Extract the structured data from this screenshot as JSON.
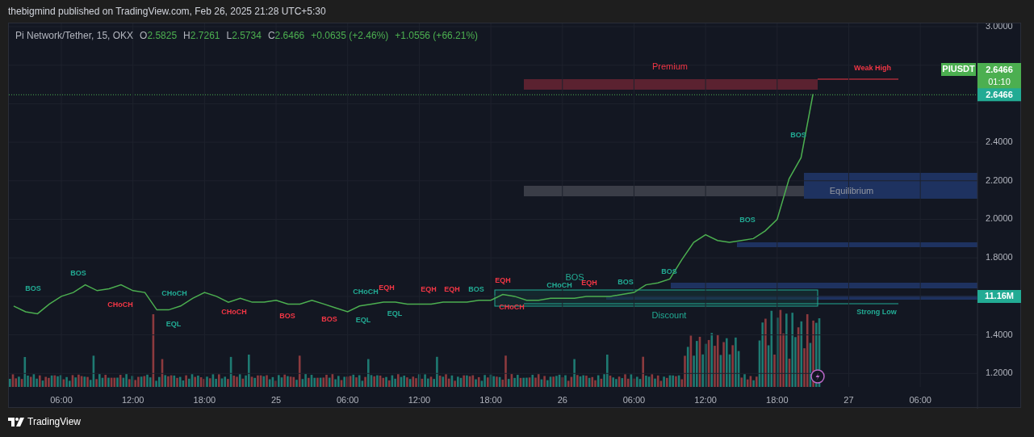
{
  "header": {
    "text": "thebigmind published on TradingView.com, Feb 26, 2025 21:28 UTC+5:30"
  },
  "legend": {
    "symbol": "Pi Network/Tether, 15, OKX",
    "ohlc": [
      {
        "key": "O",
        "value": "2.5825"
      },
      {
        "key": "H",
        "value": "2.7261"
      },
      {
        "key": "L",
        "value": "2.5734"
      },
      {
        "key": "C",
        "value": "2.6466"
      }
    ],
    "change": "+0.0635 (+2.46%)",
    "change_total": "+1.0556 (+66.21%)"
  },
  "chart": {
    "chart_data": {
      "type": "line",
      "categories": [
        null,
        null,
        null,
        null,
        null,
        null,
        null,
        null,
        null,
        null,
        null,
        null,
        null,
        null,
        null,
        null,
        null,
        null,
        null,
        null,
        null,
        null,
        null,
        null,
        null,
        null,
        null,
        null,
        null,
        null,
        null,
        null,
        null,
        null,
        null,
        null,
        null,
        null,
        null,
        null,
        null,
        null,
        null,
        null,
        null,
        null,
        null,
        null,
        null,
        null,
        null,
        null,
        null,
        null,
        null,
        null,
        null,
        null,
        null,
        null,
        null,
        null,
        null,
        null,
        null,
        null,
        null,
        null
      ],
      "series": [
        {
          "name": "PIUSDT",
          "color": "#4caf50",
          "values": [
            1.55,
            1.52,
            1.51,
            1.56,
            1.6,
            1.62,
            1.66,
            1.63,
            1.64,
            1.66,
            1.63,
            1.62,
            1.53,
            1.53,
            1.55,
            1.59,
            1.62,
            1.6,
            1.57,
            1.59,
            1.57,
            1.57,
            1.58,
            1.56,
            1.56,
            1.58,
            1.56,
            1.54,
            1.52,
            1.55,
            1.56,
            1.57,
            1.57,
            1.56,
            1.56,
            1.56,
            1.57,
            1.57,
            1.57,
            1.58,
            1.58,
            1.61,
            1.6,
            1.58,
            1.58,
            1.59,
            1.59,
            1.59,
            1.6,
            1.6,
            1.6,
            1.61,
            1.62,
            1.66,
            1.67,
            1.69,
            1.79,
            1.88,
            1.92,
            1.89,
            1.88,
            1.89,
            1.9,
            1.94,
            2.0,
            2.21,
            2.32,
            2.65
          ]
        }
      ],
      "ylim": [
        1.0168,
        3.0168
      ],
      "grid": true,
      "yticks": [
        {
          "value": 1.2,
          "label": "1.2000"
        },
        {
          "value": 1.4,
          "label": "1.4000"
        },
        {
          "value": 1.8,
          "label": "1.8000"
        },
        {
          "value": 2.0,
          "label": "2.0000"
        },
        {
          "value": 2.2,
          "label": "2.2000"
        },
        {
          "value": 2.4,
          "label": "2.4000"
        },
        {
          "value": 3.0,
          "label": "3.0000"
        }
      ]
    },
    "time_axis": [
      "06:00",
      "12:00",
      "18:00",
      "25",
      "06:00",
      "12:00",
      "18:00",
      "26",
      "06:00",
      "12:00",
      "18:00",
      "27",
      "06:00"
    ],
    "structure_labels": [
      {
        "text": "BOS",
        "color": "#22ab94"
      },
      {
        "text": "BOS",
        "color": "#22ab94"
      },
      {
        "text": "CHoCH",
        "color": "#f23645"
      },
      {
        "text": "CHoCH",
        "color": "#22ab94"
      },
      {
        "text": "EQL",
        "color": "#22ab94"
      },
      {
        "text": "CHoCH",
        "color": "#f23645"
      },
      {
        "text": "BOS",
        "color": "#f23645"
      },
      {
        "text": "BOS",
        "color": "#f23645"
      },
      {
        "text": "CHoCH",
        "color": "#22ab94"
      },
      {
        "text": "EQH",
        "color": "#f23645"
      },
      {
        "text": "EQL",
        "color": "#22ab94"
      },
      {
        "text": "EQL",
        "color": "#22ab94"
      },
      {
        "text": "EQH",
        "color": "#f23645"
      },
      {
        "text": "EQH",
        "color": "#f23645"
      },
      {
        "text": "BOS",
        "color": "#22ab94"
      },
      {
        "text": "EQH",
        "color": "#f23645"
      },
      {
        "text": "CHoCH",
        "color": "#f23645"
      },
      {
        "text": "CHoCH",
        "color": "#22ab94"
      },
      {
        "text": "BOS",
        "color": "#22ab94"
      },
      {
        "text": "EQH",
        "color": "#f23645"
      },
      {
        "text": "BOS",
        "color": "#22ab94"
      },
      {
        "text": "BOS",
        "color": "#22ab94"
      },
      {
        "text": "BOS",
        "color": "#22ab94"
      },
      {
        "text": "BOS",
        "color": "#22ab94"
      },
      {
        "text": "Weak High",
        "color": "#f23645"
      },
      {
        "text": "Strong Low",
        "color": "#22ab94"
      }
    ],
    "zone_labels": [
      {
        "text": "Premium",
        "color": "#f23645"
      },
      {
        "text": "Equilibrium",
        "color": "#9598a1"
      },
      {
        "text": "Discount",
        "color": "#22ab94"
      }
    ],
    "last_price": "2.6466",
    "countdown": "01:10",
    "price_line_label": "2.6466",
    "volume_badge": "11.16M"
  },
  "footer": {
    "logo_text": "TradingView"
  }
}
